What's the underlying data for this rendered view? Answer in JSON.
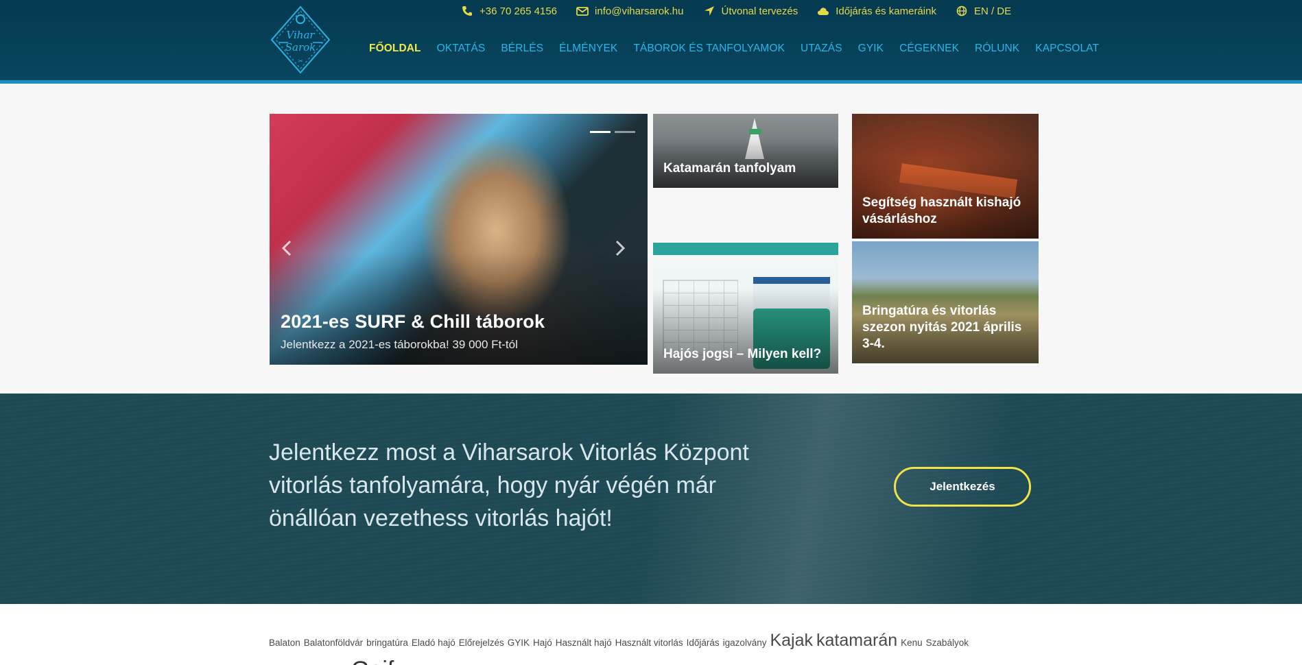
{
  "header": {
    "logo_text": "Vihar Sarok",
    "topbar": [
      {
        "icon": "phone-icon",
        "label": "+36 70 265 4156"
      },
      {
        "icon": "mail-icon",
        "label": "info@viharsarok.hu"
      },
      {
        "icon": "location-arrow-icon",
        "label": "Útvonal tervezés"
      },
      {
        "icon": "cloud-icon",
        "label": "Időjárás és kameráink"
      },
      {
        "icon": "globe-icon",
        "label": "EN / DE"
      }
    ],
    "nav": [
      {
        "label": "FŐOLDAL",
        "active": true
      },
      {
        "label": "OKTATÁS"
      },
      {
        "label": "BÉRLÉS"
      },
      {
        "label": "ÉLMÉNYEK"
      },
      {
        "label": "TÁBOROK ÉS TANFOLYAMOK"
      },
      {
        "label": "UTAZÁS"
      },
      {
        "label": "GYIK"
      },
      {
        "label": "CÉGEKNEK"
      },
      {
        "label": "RÓLUNK"
      },
      {
        "label": "KAPCSOLAT"
      }
    ],
    "accent_color": "#f1e84b",
    "link_color": "#29b6e8"
  },
  "slider": {
    "title": "2021-es SURF & Chill táborok",
    "subtitle": "Jelentkezz a 2021-es táborokba! 39 000 Ft-tól",
    "slide_count": 2,
    "active_slide": 1
  },
  "tiles": [
    {
      "title": "Katamarán tanfolyam"
    },
    {
      "title": "Hajós jogsi – Milyen kell?"
    },
    {
      "title": "Segítség használt kishajó vásárláshoz"
    },
    {
      "title": "Bringatúra és vitorlás szezon nyitás 2021 április 3-4."
    }
  ],
  "cta": {
    "text": "Jelentkezz most a Viharsarok Vitorlás Központ vitorlás tanfolyamára, hogy nyár végén már önállóan vezethess vitorlás hajót!",
    "button": "Jelentkezés",
    "button_border_color": "#efe34a"
  },
  "tags": [
    {
      "label": "Balaton",
      "size": "small"
    },
    {
      "label": "Balatonföldvár",
      "size": "small"
    },
    {
      "label": "bringatúra",
      "size": "small"
    },
    {
      "label": "Eladó hajó",
      "size": "small"
    },
    {
      "label": "Előrejelzés",
      "size": "small"
    },
    {
      "label": "GYIK",
      "size": "small"
    },
    {
      "label": "Hajó",
      "size": "small"
    },
    {
      "label": "Használt hajó",
      "size": "small"
    },
    {
      "label": "Használt vitorlás",
      "size": "small"
    },
    {
      "label": "Időjárás",
      "size": "small"
    },
    {
      "label": "igazolvány",
      "size": "small"
    },
    {
      "label": "Kajak",
      "size": "big"
    },
    {
      "label": "katamarán",
      "size": "big"
    },
    {
      "label": "Kenu",
      "size": "small"
    },
    {
      "label": "Szabályok",
      "size": "small"
    }
  ],
  "partial_heading": "Geif"
}
